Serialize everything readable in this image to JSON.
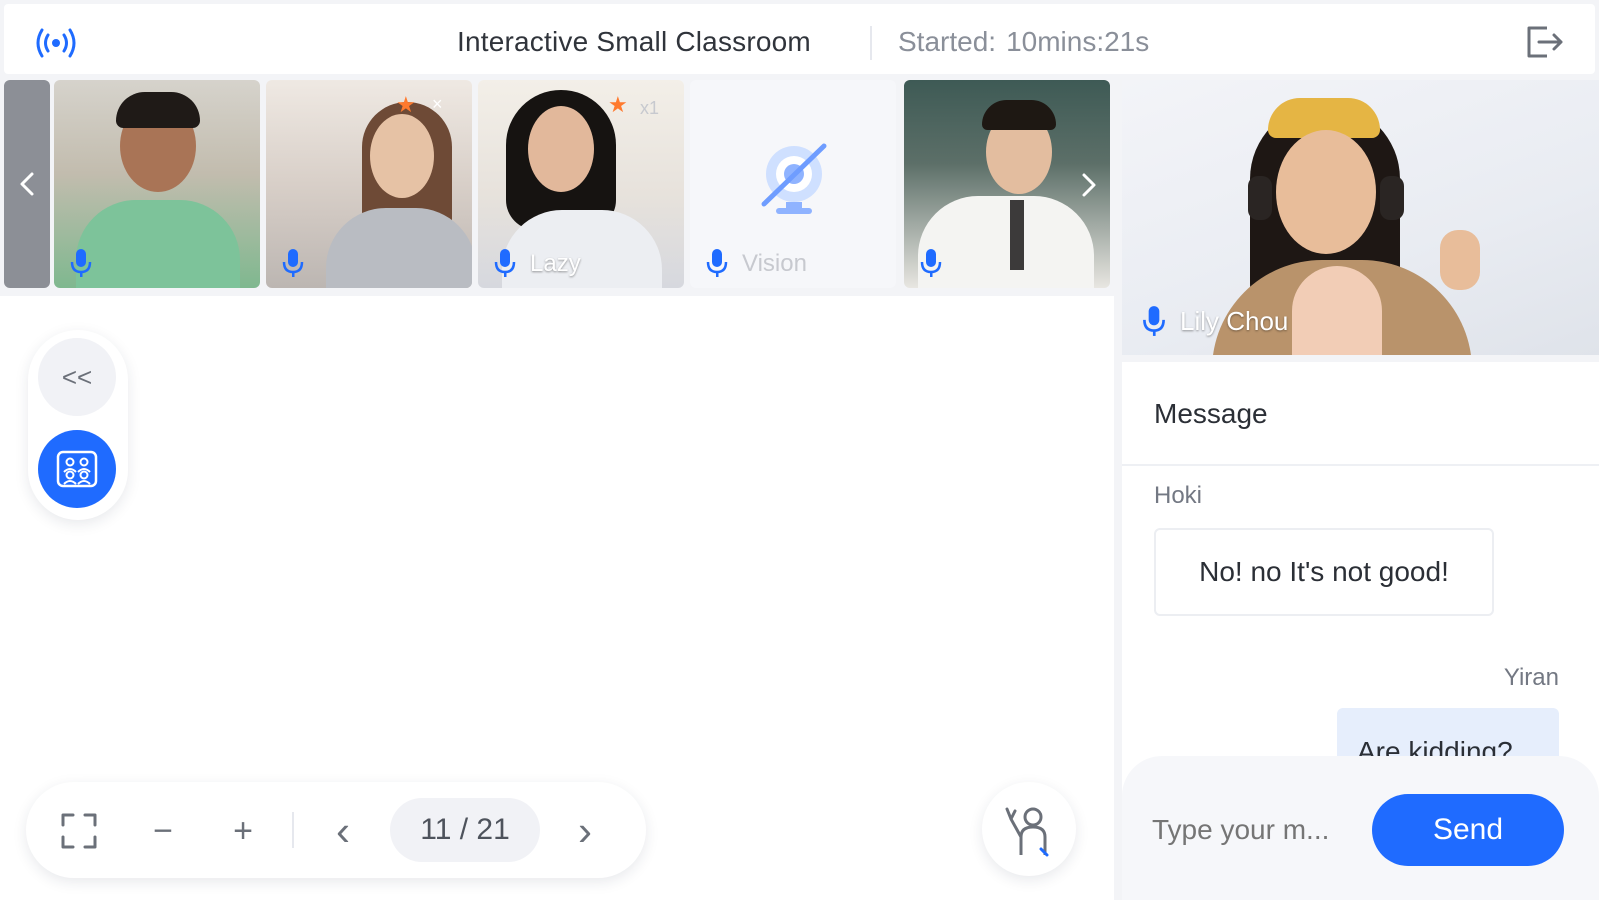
{
  "header": {
    "title": "Interactive Small Classroom",
    "started_label": "Started:",
    "started_value": "10mins:21s",
    "signal_icon": "signal-icon",
    "exit_icon": "exit-icon"
  },
  "strip": {
    "prev_icon": "chevron-left-icon",
    "next_icon": "chevron-right-icon",
    "tiles": [
      {
        "name": "",
        "mic": "microphone-icon"
      },
      {
        "name": "",
        "star": "★",
        "close": "×",
        "mic": "microphone-icon"
      },
      {
        "name": "Lazy",
        "star": "★",
        "count": "x1",
        "mic": "microphone-icon"
      },
      {
        "name": "Vision",
        "camera": "camera-off-icon",
        "mic": "microphone-icon"
      },
      {
        "name": "",
        "mic": "microphone-icon"
      }
    ]
  },
  "teacher": {
    "name": "Lily Chou",
    "mic": "microphone-icon"
  },
  "tools": {
    "collapse_label": "<<",
    "grid_icon": "people-grid-icon"
  },
  "bottom_bar": {
    "fullscreen_icon": "fullscreen-icon",
    "zoom_out_label": "−",
    "zoom_in_label": "+",
    "prev_label": "‹",
    "page": "11 / 21",
    "next_label": "›"
  },
  "hand_icon": "raise-hand-icon",
  "chat": {
    "title": "Message",
    "messages": [
      {
        "sender": "Hoki",
        "text": "No! no It's not good!"
      },
      {
        "sender": "Yiran",
        "text": "Are kidding?"
      }
    ],
    "input_placeholder": "Type your m...",
    "send_label": "Send"
  },
  "colors": {
    "accent": "#1f6bff",
    "mic": "#1f6bff",
    "star": "#ff7a2e",
    "bubble_self": "#e6eefc"
  }
}
